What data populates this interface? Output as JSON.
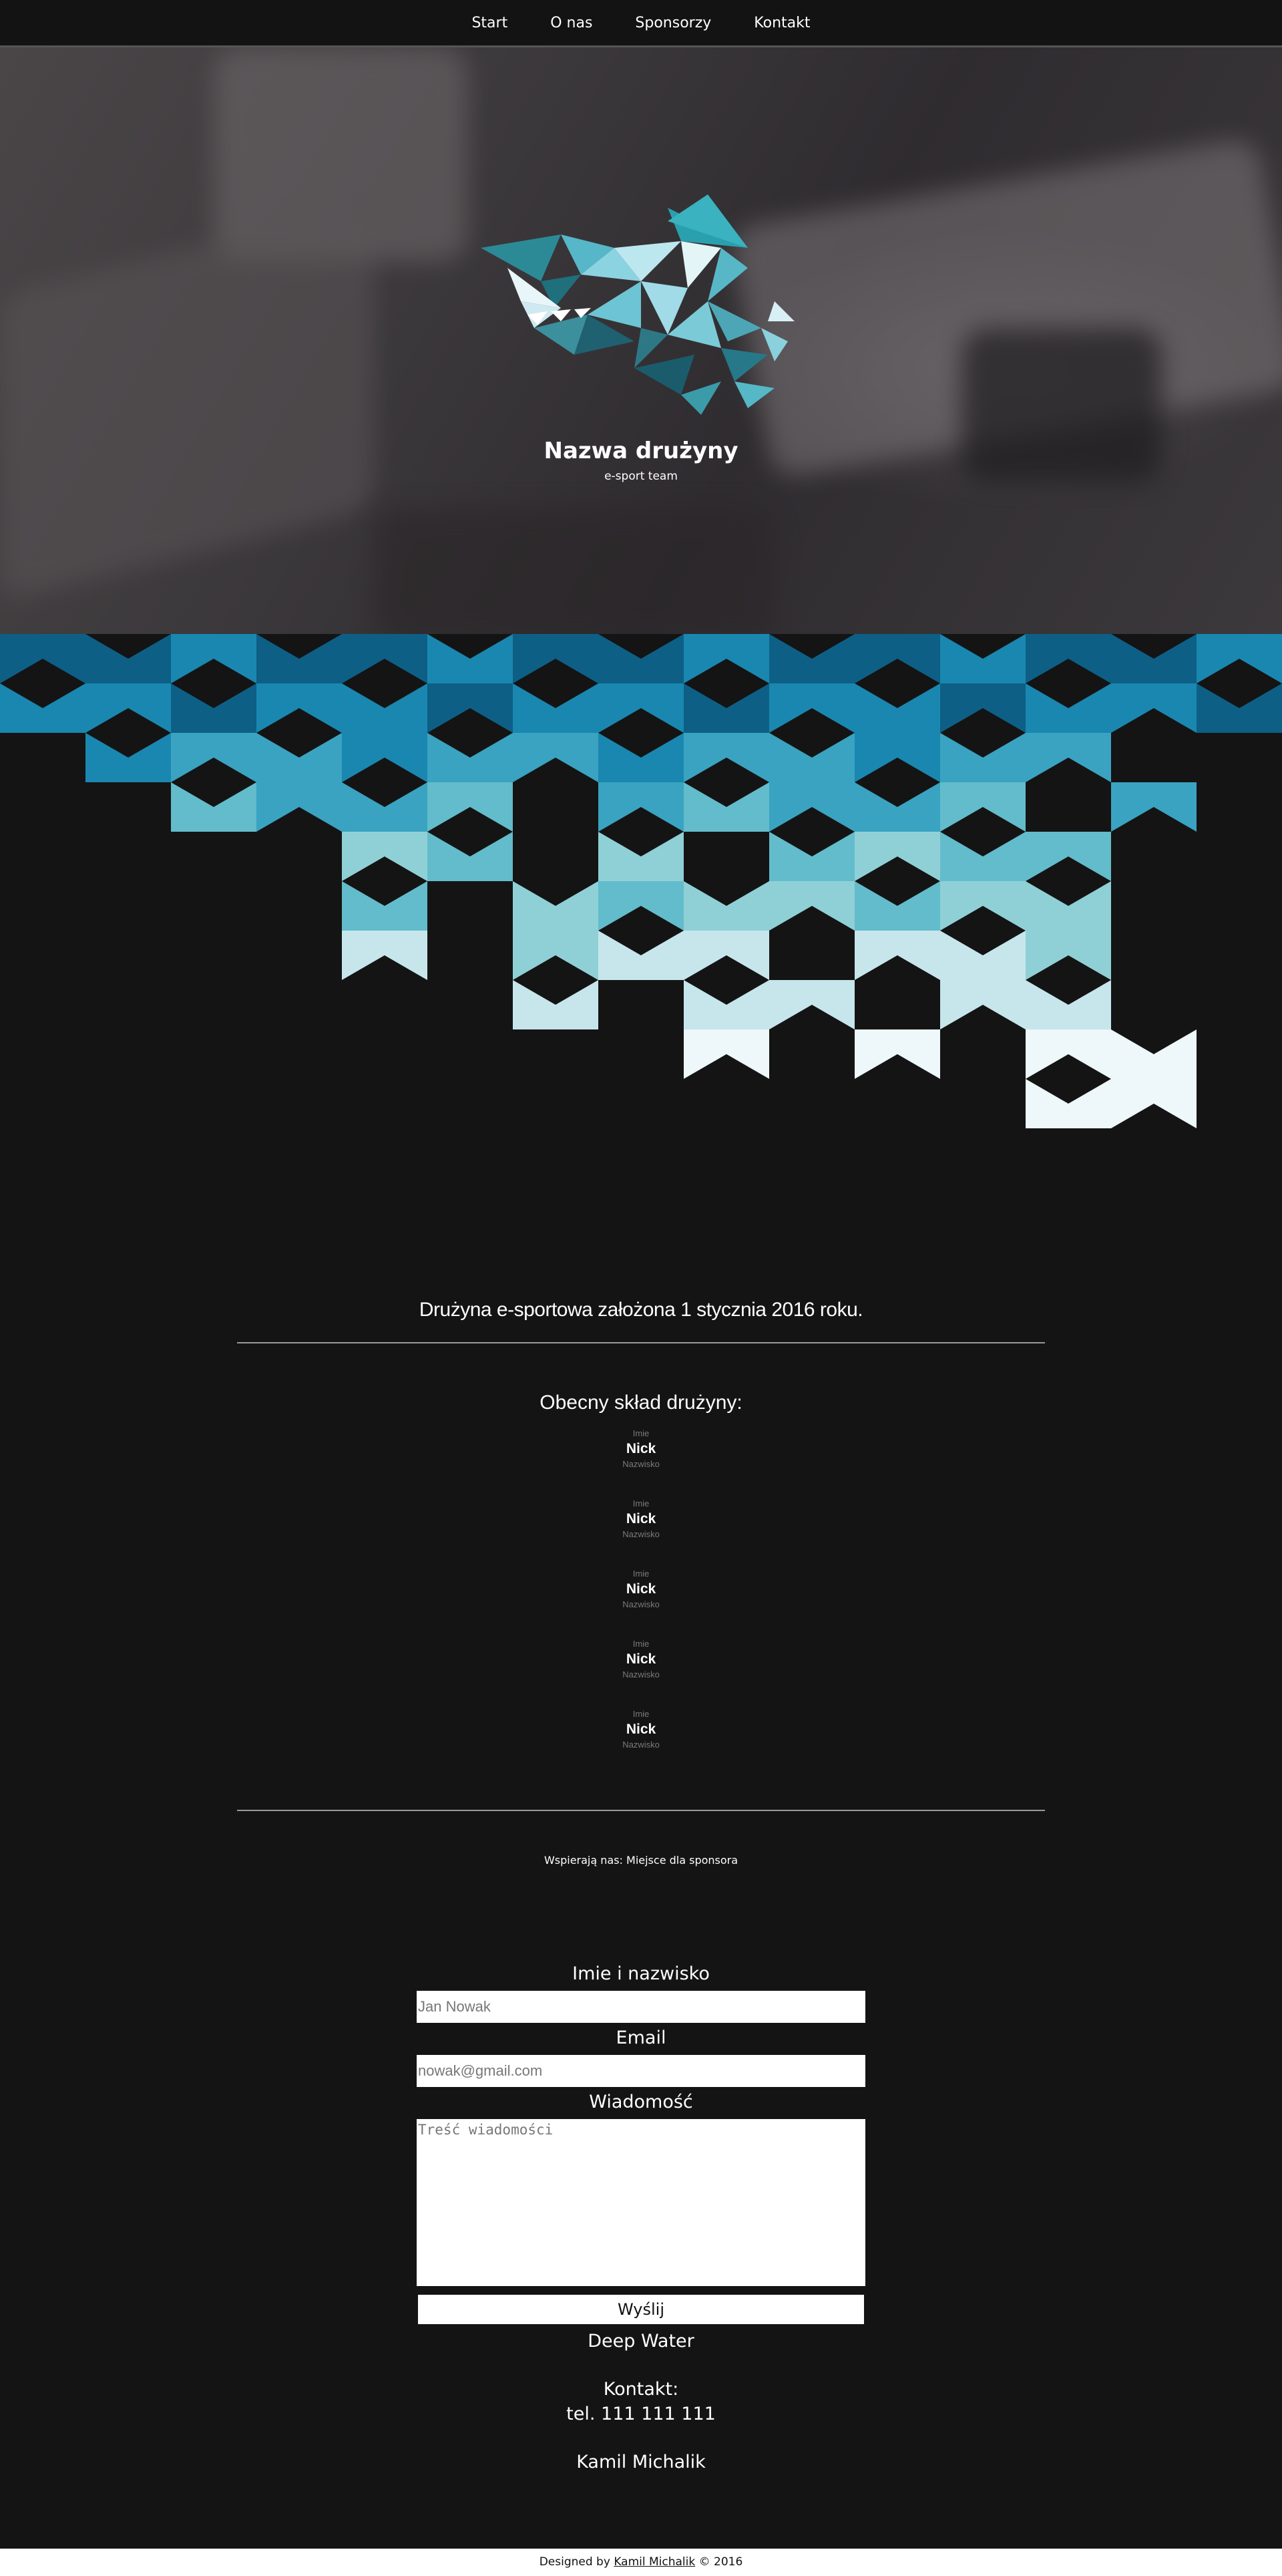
{
  "nav": {
    "items": [
      {
        "label": "Start"
      },
      {
        "label": "O nas"
      },
      {
        "label": "Sponsorzy"
      },
      {
        "label": "Kontakt"
      }
    ]
  },
  "hero": {
    "title": "Nazwa drużyny",
    "subtitle": "e-sport team",
    "logo_icon": "shark-logo-icon"
  },
  "about": {
    "founded_text": "Drużyna e-sportowa założona 1 stycznia 2016 roku.",
    "roster_title": "Obecny skład drużyny:",
    "members": [
      {
        "first": "Imie",
        "nick": "Nick",
        "last": "Nazwisko"
      },
      {
        "first": "Imie",
        "nick": "Nick",
        "last": "Nazwisko"
      },
      {
        "first": "Imie",
        "nick": "Nick",
        "last": "Nazwisko"
      },
      {
        "first": "Imie",
        "nick": "Nick",
        "last": "Nazwisko"
      },
      {
        "first": "Imie",
        "nick": "Nick",
        "last": "Nazwisko"
      }
    ]
  },
  "sponsors": {
    "text": "Wspierają nas: Miejsce dla sponsora"
  },
  "contact_form": {
    "name_label": "Imie i nazwisko",
    "name_placeholder": "Jan Nowak",
    "email_label": "Email",
    "email_placeholder": "nowak@gmail.com",
    "message_label": "Wiadomość",
    "message_placeholder": "Treść wiadomości",
    "submit_label": "Wyślij"
  },
  "contact_info": {
    "team_name": "Deep Water",
    "contact_heading": "Kontakt:",
    "phone": "tel. 111 111 111",
    "person": "Kamil Michalik"
  },
  "footer": {
    "prefix": "Designed by ",
    "author_link": "Kamil Michalik",
    "suffix": " © 2016"
  },
  "colors": {
    "background": "#141414",
    "triangle_palette": [
      "#0d5f86",
      "#1a87b0",
      "#3aa3c1",
      "#63bccb",
      "#8fd0d6",
      "#c6e6ec",
      "#eef7f9"
    ]
  }
}
